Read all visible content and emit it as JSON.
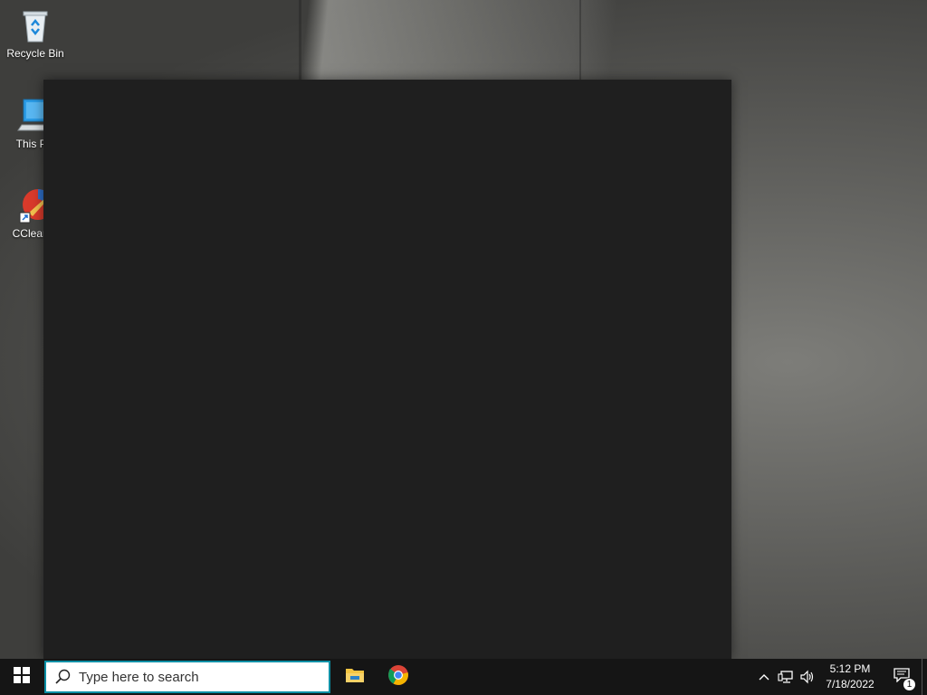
{
  "desktop": {
    "icons": [
      {
        "label": "Recycle Bin",
        "icon": "recycle-bin-icon"
      },
      {
        "label": "This PC",
        "icon": "this-pc-icon"
      },
      {
        "label": "CCleaner",
        "icon": "ccleaner-icon"
      }
    ]
  },
  "window": {
    "background": "#1f1f1f"
  },
  "taskbar": {
    "start_icon": "windows-logo-icon",
    "search": {
      "placeholder": "Type here to search",
      "accent": "#0b8fa5"
    },
    "pinned": [
      {
        "name": "File Explorer",
        "icon": "file-explorer-icon"
      },
      {
        "name": "Google Chrome",
        "icon": "chrome-icon"
      }
    ],
    "tray": {
      "icons": [
        "chevron-up-icon",
        "network-icon",
        "volume-icon"
      ],
      "time": "5:12 PM",
      "date": "7/18/2022",
      "notification_count": "1"
    }
  }
}
